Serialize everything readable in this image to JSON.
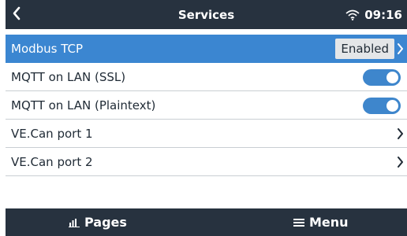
{
  "header": {
    "title": "Services",
    "time": "09:16",
    "icons": {
      "back": "chevron-left-icon",
      "wifi": "wifi-icon"
    }
  },
  "list": {
    "items": [
      {
        "label": "Modbus TCP",
        "value": "Enabled",
        "type": "submenu",
        "selected": true
      },
      {
        "label": "MQTT on LAN (SSL)",
        "type": "toggle",
        "checked": true
      },
      {
        "label": "MQTT on LAN (Plaintext)",
        "type": "toggle",
        "checked": true
      },
      {
        "label": "VE.Can port 1",
        "type": "submenu"
      },
      {
        "label": "VE.Can port 2",
        "type": "submenu"
      }
    ]
  },
  "footer": {
    "pages_label": "Pages",
    "menu_label": "Menu",
    "icons": {
      "pages": "bar-chart-icon",
      "menu": "hamburger-menu-icon"
    }
  },
  "colors": {
    "bar_background": "#27323f",
    "selected_row": "#3b86d1",
    "toggle_on": "#3e86cc"
  }
}
